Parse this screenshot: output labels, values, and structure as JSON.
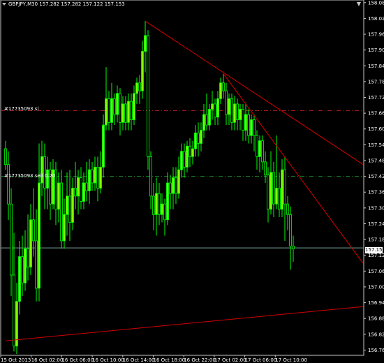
{
  "window": {
    "title": "GBPJPY,M30",
    "ohlc": "157.282 157.282 157.122 157.153",
    "title_full": "GBPJPY,M30  157.282 157.282 157.122 157.153",
    "corner_icon": "arrow-down-icon"
  },
  "orders": {
    "sl_label": "#17735093 sl",
    "sell_label": "#17735093 sell 0.20"
  },
  "bid": {
    "price": "157.153"
  },
  "colors": {
    "background": "#000000",
    "bull_candle": "#7cfc00",
    "bear_candle": "#000000",
    "wick": "#00ff00",
    "trendline": "#d40000",
    "sl_line": "#b01e1e",
    "sell_line": "#1c8c2a",
    "bid_line": "#7aa7a0",
    "axis_text": "#ffffff"
  },
  "chart_data": {
    "type": "candlestick",
    "symbol": "GBPJPY",
    "timeframe": "M30",
    "ylim": [
      156.745,
      158.095
    ],
    "y_ticks": [
      "158.085",
      "158.025",
      "157.965",
      "157.905",
      "157.845",
      "157.785",
      "157.725",
      "157.665",
      "157.605",
      "157.545",
      "157.485",
      "157.425",
      "157.365",
      "157.305",
      "157.245",
      "157.185",
      "157.125",
      "157.065",
      "157.005",
      "156.945",
      "156.885",
      "156.825",
      "156.765"
    ],
    "x_ticks": [
      "15 Oct 2013",
      "16 Oct 02:00",
      "16 Oct 06:00",
      "16 Oct 10:00",
      "16 Oct 14:00",
      "16 Oct 18:00",
      "16 Oct 22:00",
      "17 Oct 02:00",
      "17 Oct 06:00",
      "17 Oct 10:00"
    ],
    "sl_price": 157.675,
    "sell_price": 157.425,
    "bid_price": 157.153,
    "trendlines": [
      {
        "from": {
          "bar": 50,
          "price": 158.015
        },
        "to": {
          "bar": 128,
          "price": 157.47
        }
      },
      {
        "from": {
          "bar": 78,
          "price": 157.815
        },
        "to": {
          "bar": 128,
          "price": 157.095
        }
      },
      {
        "from": {
          "bar": 0,
          "price": 156.8
        },
        "to": {
          "bar": 128,
          "price": 156.93
        }
      }
    ],
    "candles": [
      [
        157.53,
        157.47,
        157.45,
        157.56
      ],
      [
        157.47,
        157.32,
        157.26,
        157.52
      ],
      [
        157.32,
        157.05,
        156.97,
        157.38
      ],
      [
        157.05,
        156.78,
        156.76,
        157.21
      ],
      [
        156.78,
        156.95,
        156.75,
        157.02
      ],
      [
        156.95,
        157.12,
        156.9,
        157.18
      ],
      [
        157.12,
        157.02,
        156.97,
        157.2
      ],
      [
        157.02,
        157.15,
        156.99,
        157.22
      ],
      [
        157.15,
        157.08,
        157.03,
        157.28
      ],
      [
        157.08,
        157.26,
        157.05,
        157.32
      ],
      [
        157.26,
        157.18,
        157.12,
        157.38
      ],
      [
        157.18,
        157.0,
        156.95,
        157.3
      ],
      [
        157.0,
        157.4,
        156.95,
        157.55
      ],
      [
        157.4,
        157.5,
        157.35,
        157.56
      ],
      [
        157.5,
        157.38,
        157.3,
        157.55
      ],
      [
        157.38,
        157.45,
        157.3,
        157.5
      ],
      [
        157.45,
        157.32,
        157.26,
        157.48
      ],
      [
        157.32,
        157.45,
        157.3,
        157.49
      ],
      [
        157.45,
        157.3,
        157.24,
        157.48
      ],
      [
        157.3,
        157.4,
        157.25,
        157.44
      ],
      [
        157.4,
        157.18,
        157.15,
        157.45
      ],
      [
        157.18,
        157.28,
        157.15,
        157.34
      ],
      [
        157.28,
        157.35,
        157.2,
        157.44
      ],
      [
        157.35,
        157.25,
        157.18,
        157.45
      ],
      [
        157.25,
        157.38,
        157.22,
        157.42
      ],
      [
        157.38,
        157.35,
        157.3,
        157.48
      ],
      [
        157.35,
        157.42,
        157.28,
        157.45
      ],
      [
        157.42,
        157.33,
        157.3,
        157.46
      ],
      [
        157.33,
        157.4,
        157.3,
        157.44
      ],
      [
        157.4,
        157.37,
        157.33,
        157.48
      ],
      [
        157.37,
        157.45,
        157.32,
        157.49
      ],
      [
        157.45,
        157.4,
        157.37,
        157.48
      ],
      [
        157.4,
        157.46,
        157.37,
        157.5
      ],
      [
        157.46,
        157.38,
        157.33,
        157.5
      ],
      [
        157.38,
        157.46,
        157.36,
        157.52
      ],
      [
        157.46,
        157.62,
        157.42,
        157.66
      ],
      [
        157.62,
        157.72,
        157.6,
        157.84
      ],
      [
        157.72,
        157.63,
        157.6,
        157.75
      ],
      [
        157.63,
        157.72,
        157.6,
        157.78
      ],
      [
        157.72,
        157.66,
        157.62,
        157.74
      ],
      [
        157.66,
        157.74,
        157.63,
        157.77
      ],
      [
        157.74,
        157.63,
        157.58,
        157.76
      ],
      [
        157.63,
        157.7,
        157.6,
        157.73
      ],
      [
        157.7,
        157.63,
        157.6,
        157.73
      ],
      [
        157.63,
        157.71,
        157.6,
        157.74
      ],
      [
        157.71,
        157.64,
        157.6,
        157.74
      ],
      [
        157.64,
        157.74,
        157.62,
        157.77
      ],
      [
        157.74,
        157.78,
        157.7,
        157.8
      ],
      [
        157.78,
        157.75,
        157.7,
        157.81
      ],
      [
        157.75,
        157.9,
        157.72,
        157.94
      ],
      [
        157.9,
        157.96,
        157.82,
        158.015
      ],
      [
        157.96,
        157.5,
        157.45,
        157.98
      ],
      [
        157.5,
        157.35,
        157.3,
        157.52
      ],
      [
        157.35,
        157.28,
        157.22,
        157.4
      ],
      [
        157.28,
        157.36,
        157.2,
        157.42
      ],
      [
        157.36,
        157.28,
        157.24,
        157.4
      ],
      [
        157.28,
        157.32,
        157.25,
        157.36
      ],
      [
        157.32,
        157.26,
        157.2,
        157.34
      ],
      [
        157.26,
        157.4,
        157.24,
        157.44
      ],
      [
        157.4,
        157.36,
        157.3,
        157.43
      ],
      [
        157.36,
        157.42,
        157.3,
        157.46
      ],
      [
        157.42,
        157.36,
        157.32,
        157.46
      ],
      [
        157.36,
        157.45,
        157.34,
        157.5
      ],
      [
        157.45,
        157.52,
        157.42,
        157.55
      ],
      [
        157.52,
        157.46,
        157.42,
        157.55
      ],
      [
        157.46,
        157.54,
        157.44,
        157.56
      ],
      [
        157.54,
        157.5,
        157.46,
        157.57
      ],
      [
        157.5,
        157.53,
        157.47,
        157.56
      ],
      [
        157.53,
        157.59,
        157.5,
        157.62
      ],
      [
        157.59,
        157.55,
        157.5,
        157.63
      ],
      [
        157.55,
        157.6,
        157.52,
        157.63
      ],
      [
        157.6,
        157.66,
        157.57,
        157.7
      ],
      [
        157.66,
        157.62,
        157.6,
        157.74
      ],
      [
        157.62,
        157.68,
        157.6,
        157.7
      ],
      [
        157.68,
        157.7,
        157.64,
        157.75
      ],
      [
        157.7,
        157.65,
        157.62,
        157.72
      ],
      [
        157.65,
        157.72,
        157.62,
        157.75
      ],
      [
        157.72,
        157.78,
        157.7,
        157.8
      ],
      [
        157.78,
        157.75,
        157.72,
        157.815
      ],
      [
        157.75,
        157.66,
        157.62,
        157.78
      ],
      [
        157.66,
        157.72,
        157.62,
        157.74
      ],
      [
        157.72,
        157.63,
        157.6,
        157.74
      ],
      [
        157.63,
        157.7,
        157.6,
        157.73
      ],
      [
        157.7,
        157.64,
        157.6,
        157.72
      ],
      [
        157.64,
        157.68,
        157.6,
        157.7
      ],
      [
        157.68,
        157.6,
        157.56,
        157.7
      ],
      [
        157.6,
        157.66,
        157.56,
        157.7
      ],
      [
        157.66,
        157.58,
        157.55,
        157.68
      ],
      [
        157.58,
        157.64,
        157.55,
        157.66
      ],
      [
        157.64,
        157.58,
        157.52,
        157.66
      ],
      [
        157.58,
        157.5,
        157.45,
        157.6
      ],
      [
        157.5,
        157.56,
        157.44,
        157.58
      ],
      [
        157.56,
        157.48,
        157.45,
        157.58
      ],
      [
        157.48,
        157.43,
        157.4,
        157.52
      ],
      [
        157.43,
        157.3,
        157.25,
        157.46
      ],
      [
        157.3,
        157.44,
        157.28,
        157.52
      ],
      [
        157.44,
        157.32,
        157.27,
        157.48
      ],
      [
        157.32,
        157.38,
        157.3,
        157.58
      ],
      [
        157.38,
        157.3,
        157.27,
        157.44
      ],
      [
        157.3,
        157.45,
        157.27,
        157.49
      ],
      [
        157.45,
        157.32,
        157.18,
        157.5
      ],
      [
        157.32,
        157.28,
        157.22,
        157.35
      ],
      [
        157.28,
        157.16,
        157.07,
        157.31
      ],
      [
        157.16,
        157.15,
        157.1,
        157.2
      ]
    ]
  }
}
